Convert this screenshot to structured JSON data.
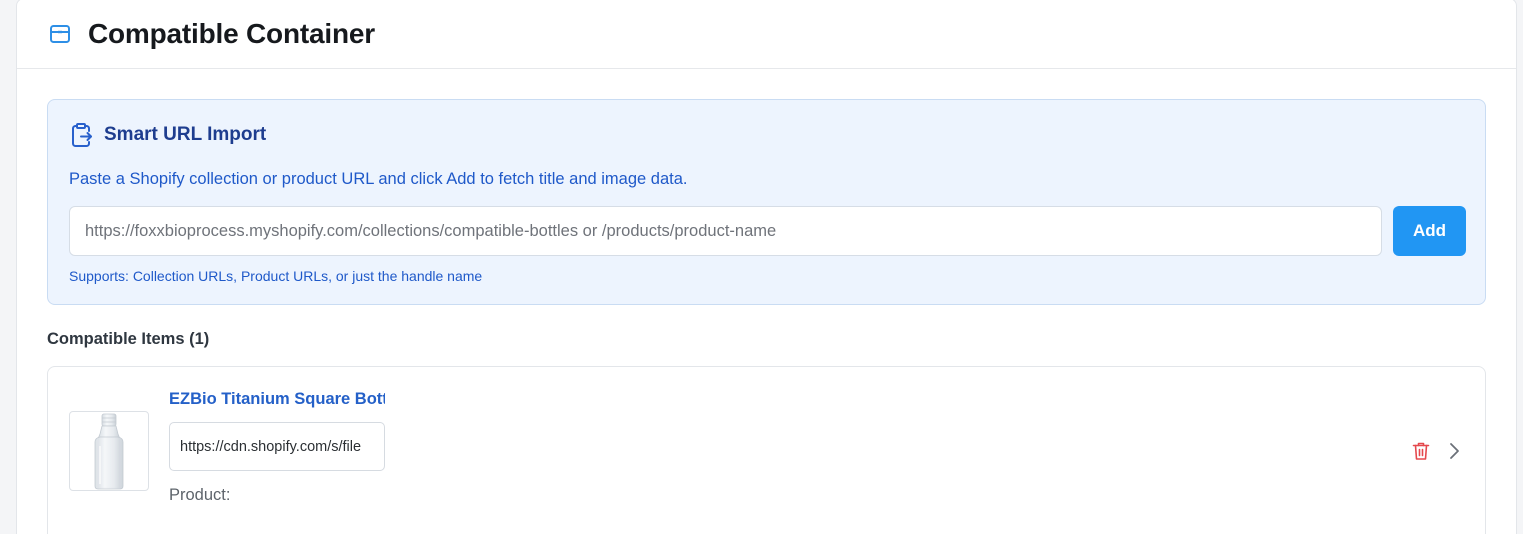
{
  "header": {
    "title": "Compatible Container",
    "icon": "box-icon",
    "icon_color": "#2e8fe6"
  },
  "import": {
    "icon": "clipboard-import-icon",
    "title": "Smart URL Import",
    "description": "Paste a Shopify collection or product URL and click Add to fetch title and image data.",
    "placeholder": "https://foxxbioprocess.myshopify.com/collections/compatible-bottles or /products/product-name",
    "value": "",
    "add_label": "Add",
    "supports": "Supports: Collection URLs, Product URLs, or just the handle name",
    "accent": "#2196f3"
  },
  "items": {
    "heading": "Compatible Items (1)",
    "list": [
      {
        "title": "EZBio Titanium Square Bott",
        "image_url": "https://cdn.shopify.com/s/file",
        "product_label": "Product:",
        "thumb_icon": "bottle-image",
        "delete_icon": "trash-icon",
        "delete_color": "#e5484d",
        "expand_icon": "chevron-right-icon"
      }
    ]
  }
}
